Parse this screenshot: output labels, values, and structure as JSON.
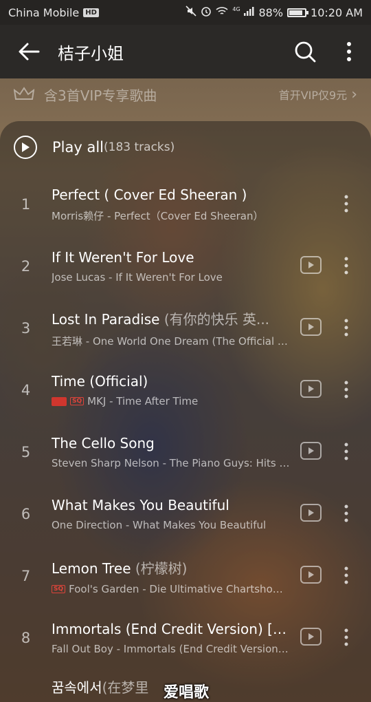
{
  "status_bar": {
    "carrier": "China Mobile",
    "hd": "HD",
    "network": "4G",
    "battery": "88%",
    "battery_level": 0.88,
    "time": "10:20 AM"
  },
  "app_bar": {
    "title": "桔子小姐",
    "icons": [
      "back-arrow-icon",
      "search-icon",
      "more-vert-icon"
    ]
  },
  "vip_banner": {
    "left_text": "含3首VIP专享歌曲",
    "right_text": "首开VIP仅9元",
    "right_arrow": "›"
  },
  "play_all": {
    "label": "Play all",
    "count": "(183 tracks)"
  },
  "tracks": [
    {
      "num": "1",
      "title": "Perfect ( Cover Ed Sheeran )",
      "alt": "",
      "subtitle": "Morris赖仔 - Perfect（Cover Ed Sheeran）",
      "mv": false,
      "badges": []
    },
    {
      "num": "2",
      "title": "If It Weren't For Love",
      "alt": "",
      "subtitle": "Jose Lucas - If It Weren't For Love",
      "mv": true,
      "badges": []
    },
    {
      "num": "3",
      "title": "Lost In Paradise ",
      "alt": "(有你的快乐 英...",
      "subtitle": "王若琳 - One World One Dream (The Official A...",
      "mv": true,
      "badges": []
    },
    {
      "num": "4",
      "title": "Time (Official)",
      "alt": "",
      "subtitle": "MKJ - Time After Time",
      "mv": true,
      "badges": [
        "vip",
        "SQ"
      ]
    },
    {
      "num": "5",
      "title": "The Cello Song",
      "alt": "",
      "subtitle": "Steven Sharp Nelson - The Piano Guys: Hits V...",
      "mv": true,
      "badges": []
    },
    {
      "num": "6",
      "title": "What Makes You Beautiful",
      "alt": "",
      "subtitle": "One Direction - What Makes You Beautiful",
      "mv": true,
      "badges": []
    },
    {
      "num": "7",
      "title": "Lemon Tree ",
      "alt": "(柠檬树)",
      "subtitle": "Fool's Garden - Die Ultimative Chartshow (...",
      "mv": true,
      "badges": [
        "SQ"
      ]
    },
    {
      "num": "8",
      "title": "Immortals (End Credit Version) [\"...",
      "alt": "",
      "subtitle": "Fall Out Boy - Immortals (End Credit Version) [...",
      "mv": true,
      "badges": []
    }
  ],
  "partial_track": {
    "title": "꿈속에서 ",
    "alt": "(在梦里"
  },
  "watermark": "爱唱歌",
  "colors": {
    "status_bar_bg": "#262422",
    "app_bar_bg": "#2b2927",
    "badge_red": "#d0362e"
  }
}
